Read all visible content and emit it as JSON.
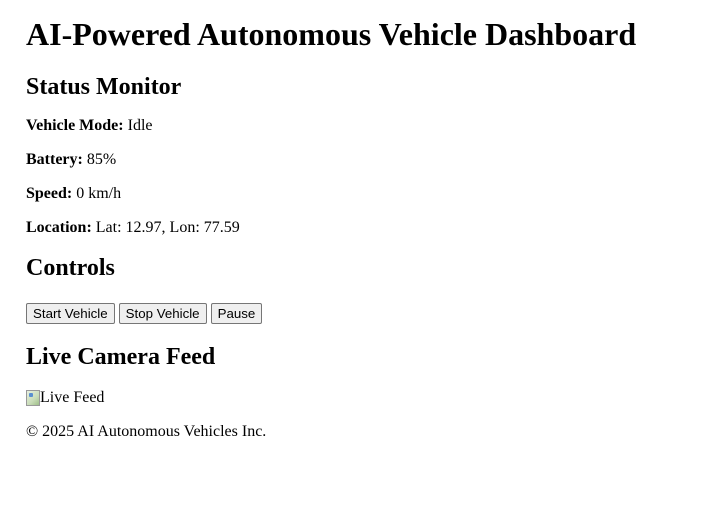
{
  "header": {
    "title": "AI-Powered Autonomous Vehicle Dashboard"
  },
  "status": {
    "heading": "Status Monitor",
    "mode_label": "Vehicle Mode:",
    "mode_value": "Idle",
    "battery_label": "Battery:",
    "battery_value": "85%",
    "speed_label": "Speed:",
    "speed_value": "0 km/h",
    "location_label": "Location:",
    "location_value": "Lat: 12.97, Lon: 77.59"
  },
  "controls": {
    "heading": "Controls",
    "start_label": "Start Vehicle",
    "stop_label": "Stop Vehicle",
    "pause_label": "Pause"
  },
  "camera": {
    "heading": "Live Camera Feed",
    "alt_text": "Live Feed",
    "icon": "broken-image-icon"
  },
  "footer": {
    "text": "© 2025 AI Autonomous Vehicles Inc."
  }
}
